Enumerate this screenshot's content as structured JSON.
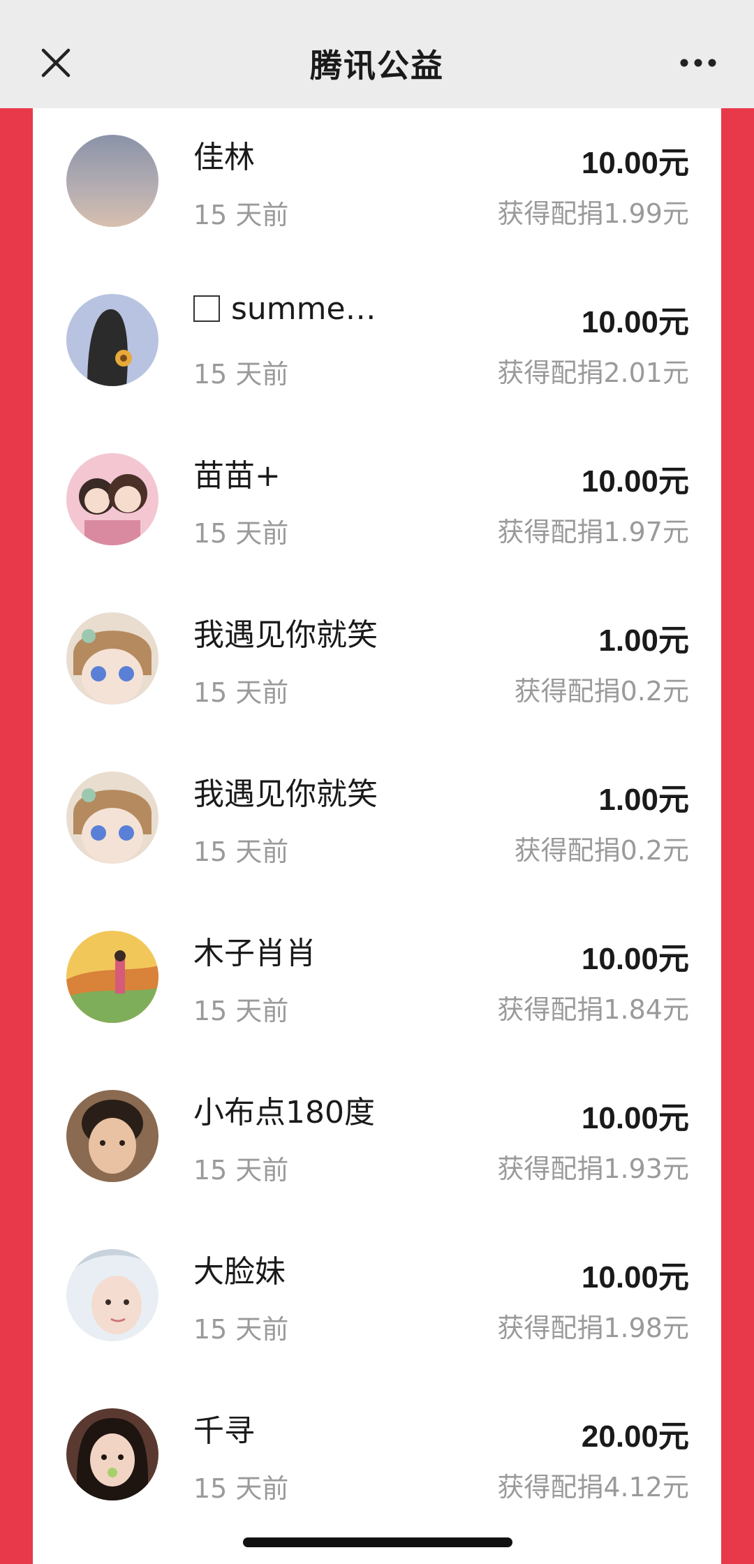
{
  "navbar": {
    "title": "腾讯公益",
    "close_icon": "close-icon",
    "more_icon": "more-horizontal-icon"
  },
  "donations": [
    {
      "name": "佳林",
      "time": "15 天前",
      "amount": "10.00元",
      "match": "获得配捐1.99元",
      "avatar": "sunset-sky"
    },
    {
      "name": "summe…",
      "has_checkbox": true,
      "time": "15 天前",
      "amount": "10.00元",
      "match": "获得配捐2.01元",
      "avatar": "girl-illustration-blue"
    },
    {
      "name": "苗苗+",
      "time": "15 天前",
      "amount": "10.00元",
      "match": "获得配捐1.97元",
      "avatar": "two-cartoon-girls"
    },
    {
      "name": "我遇见你就笑",
      "time": "15 天前",
      "amount": "1.00元",
      "match": "获得配捐0.2元",
      "avatar": "anime-doll"
    },
    {
      "name": "我遇见你就笑",
      "time": "15 天前",
      "amount": "1.00元",
      "match": "获得配捐0.2元",
      "avatar": "anime-doll"
    },
    {
      "name": "木子肖肖",
      "time": "15 天前",
      "amount": "10.00元",
      "match": "获得配捐1.84元",
      "avatar": "landscape-painting"
    },
    {
      "name": "小布点180度",
      "time": "15 天前",
      "amount": "10.00元",
      "match": "获得配捐1.93元",
      "avatar": "boy-photo"
    },
    {
      "name": "大脸妹",
      "time": "15 天前",
      "amount": "10.00元",
      "match": "获得配捐1.98元",
      "avatar": "girl-photo-light"
    },
    {
      "name": "千寻",
      "time": "15 天前",
      "amount": "20.00元",
      "match": "获得配捐4.12元",
      "avatar": "girl-photo-dark"
    }
  ],
  "colors": {
    "brand_red": "#e8394a",
    "text_primary": "#1a1a1a",
    "text_secondary": "#9a9a9a"
  }
}
